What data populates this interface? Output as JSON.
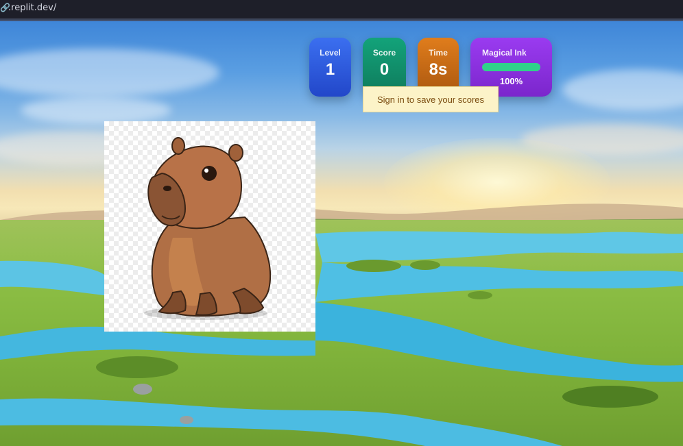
{
  "browser": {
    "url": ".replit.dev/",
    "link_icon": "link-icon"
  },
  "hud": {
    "level_label": "Level",
    "level_value": "1",
    "score_label": "Score",
    "score_value": "0",
    "time_label": "Time",
    "time_value": "8s",
    "ink_label": "Magical Ink",
    "ink_percent_text": "100%",
    "ink_fraction": 1.0
  },
  "tooltip": {
    "text": "Sign in to save your scores"
  },
  "colors": {
    "level": "#2a55d8",
    "score": "#11906b",
    "time": "#c66a16",
    "ink": "#8a30df",
    "ink_bar": "#2fd28a",
    "tooltip_bg": "#fcf3c8"
  },
  "scene": {
    "card_subject": "capybara-image"
  }
}
